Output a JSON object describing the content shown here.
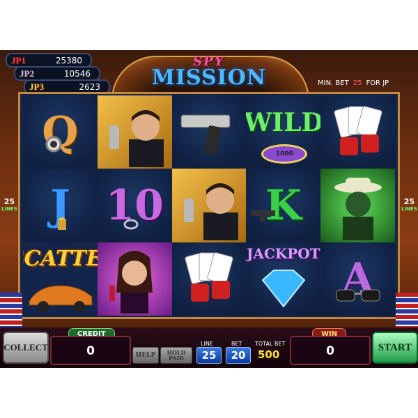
{
  "jackpots": [
    {
      "label": "JP1",
      "value": "25380"
    },
    {
      "label": "JP2",
      "value": "10546"
    },
    {
      "label": "JP3",
      "value": "2623"
    }
  ],
  "title": {
    "line1": "SPY",
    "line2": "MISSION"
  },
  "min_bet": {
    "label": "MIN. BET",
    "value": "25",
    "suffix": "FOR JP"
  },
  "lines_side": {
    "value": "25",
    "unit": "LINES"
  },
  "reels": [
    [
      "Q",
      "agent-pistol",
      "pistol",
      "WILD",
      "cards-dice"
    ],
    [
      "J",
      "10",
      "agent-pistol",
      "K",
      "villain"
    ],
    [
      "SCATTER",
      "woman-lipstick",
      "cards-dice",
      "JACKPOT",
      "A"
    ]
  ],
  "symbol_text": {
    "wild": "WILD",
    "scatter": "SCATTER",
    "jackpot": "JACKPOT",
    "chip": "1000"
  },
  "controls": {
    "collect": "COLLECT",
    "credit_label": "CREDIT",
    "credit_value": "0",
    "help": "HELP",
    "hold": "HOLD PAIR",
    "line_label": "LINE",
    "line_value": "25",
    "bet_label": "BET",
    "bet_value": "20",
    "total_bet_label": "TOTAL BET",
    "total_bet_value": "500",
    "win_label": "WIN",
    "win_value": "0",
    "start": "START"
  },
  "colors": {
    "reel_bg": "#13254a",
    "frame_gold": "#c28a3a",
    "jp_red": "#ff4040",
    "total_bet": "#ffe23a"
  }
}
